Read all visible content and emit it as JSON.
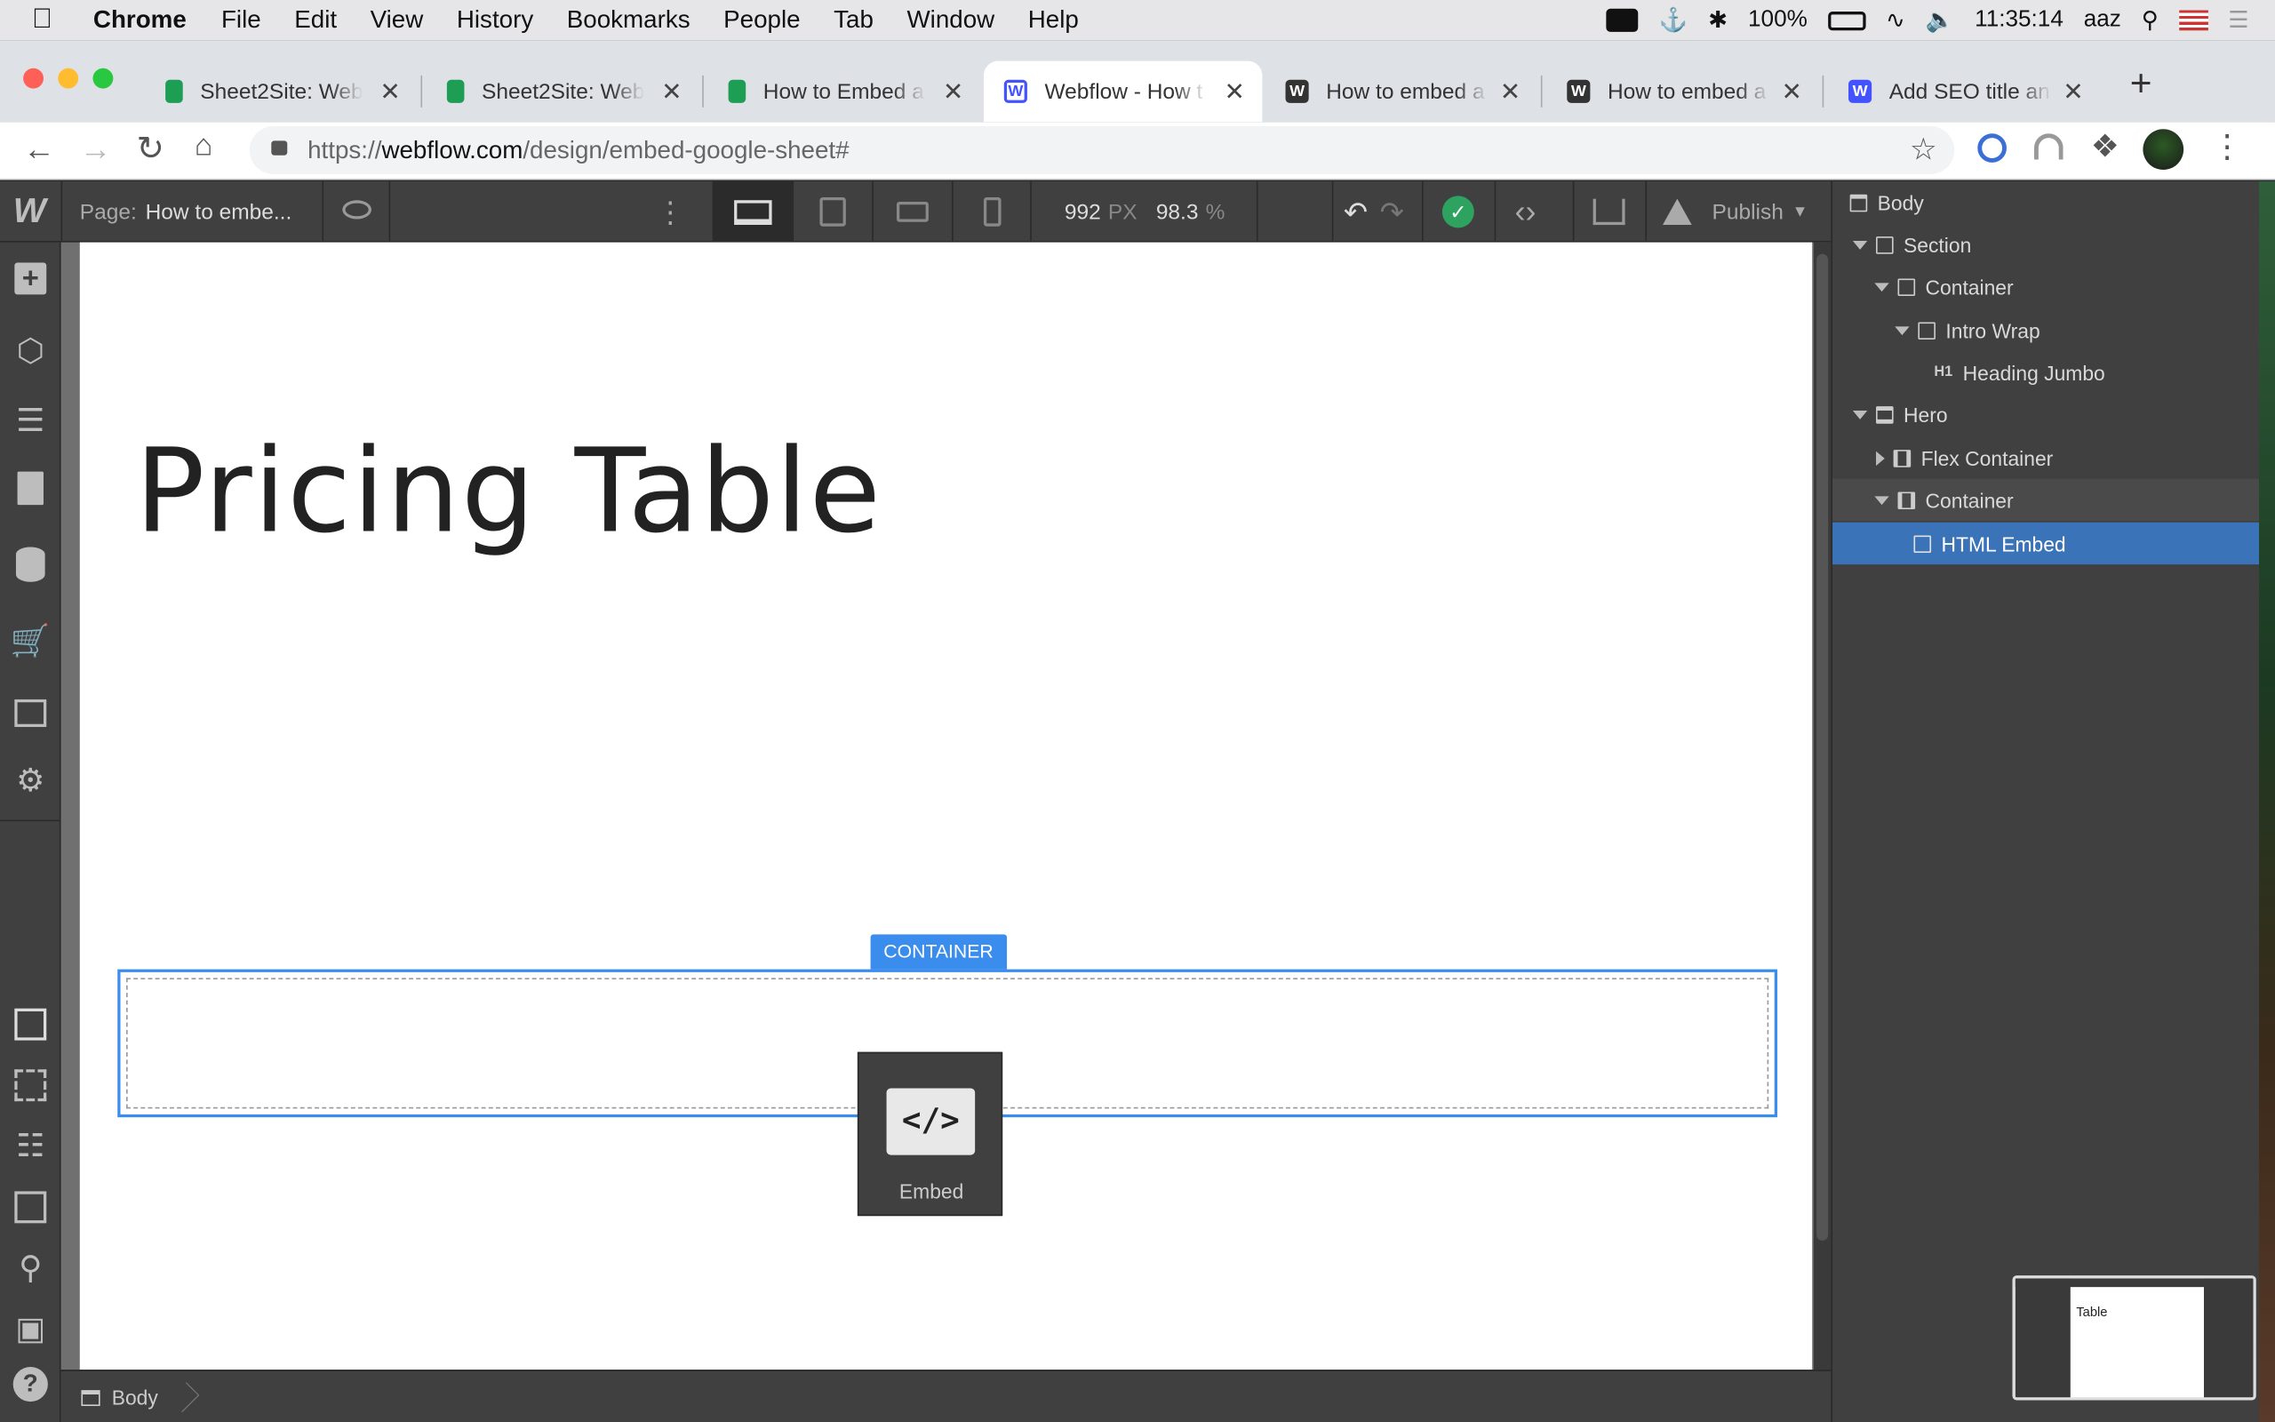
{
  "menubar": {
    "app": "Chrome",
    "items": [
      "File",
      "Edit",
      "View",
      "History",
      "Bookmarks",
      "People",
      "Tab",
      "Window",
      "Help"
    ],
    "battery": "100%",
    "clock": "11:35:14",
    "user": "aaz"
  },
  "tabs": [
    {
      "label": "Sheet2Site: Web",
      "color": "#1e9e55"
    },
    {
      "label": "Sheet2Site: Web",
      "color": "#1e9e55"
    },
    {
      "label": "How to Embed a",
      "color": "#1e9e55"
    },
    {
      "label": "Webflow - How t",
      "color": "#4353ff"
    },
    {
      "label": "How to embed a",
      "color": "#333333"
    },
    {
      "label": "How to embed a",
      "color": "#333333"
    },
    {
      "label": "Add SEO title an",
      "color": "#4353ff"
    }
  ],
  "new_tab_symbol": "+",
  "url": {
    "host_prefix": "https://",
    "host": "webflow.com",
    "path": "/design/embed-google-sheet#"
  },
  "designer": {
    "page_label": "Page:",
    "page_name": "How to embe...",
    "width_value": "992",
    "width_unit": "PX",
    "zoom_value": "98.3",
    "zoom_unit": "%",
    "publish_label": "Publish",
    "logo": "W"
  },
  "canvas": {
    "heading": "Pricing Table",
    "container_badge": "CONTAINER",
    "embed_label": "Embed",
    "embed_symbol": "</>"
  },
  "breadcrumb": {
    "item": "Body"
  },
  "navigator": [
    {
      "label": "Body",
      "icon": "body-icon"
    },
    {
      "label": "Section",
      "icon": "box-icon"
    },
    {
      "label": "Container",
      "icon": "box-icon"
    },
    {
      "label": "Intro Wrap",
      "icon": "box-icon"
    },
    {
      "label": "Heading Jumbo",
      "icon": "h1-icon",
      "prefix": "H1"
    },
    {
      "label": "Hero",
      "icon": "section-icon"
    },
    {
      "label": "Flex Container",
      "icon": "container-icon"
    },
    {
      "label": "Container",
      "icon": "container-icon"
    },
    {
      "label": "HTML Embed",
      "icon": "embed-icon"
    }
  ],
  "thumbnail": {
    "text": "Table"
  },
  "colors": {
    "accent": "#3b8ded",
    "selected": "#3a73b8",
    "publish_check": "#2ea360"
  }
}
